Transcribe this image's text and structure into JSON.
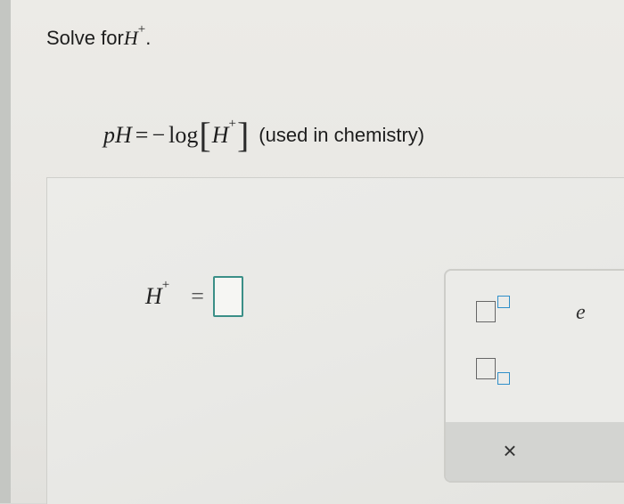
{
  "prompt": {
    "text": "Solve for ",
    "variable": "H",
    "superscript": "+",
    "period": "."
  },
  "formula": {
    "lhs": "pH",
    "equals": "=",
    "minus": "−",
    "func": "log",
    "open_bracket": "[",
    "arg": "H",
    "arg_superscript": "+",
    "close_bracket": "]",
    "note": "(used in chemistry)"
  },
  "answer": {
    "variable": "H",
    "superscript": "+",
    "equals": "=",
    "value": ""
  },
  "toolbar": {
    "superscript_tool": "superscript-template-icon",
    "subscript_tool": "subscript-template-icon",
    "e_label": "e",
    "clear_label": "×",
    "undo_label": "↶"
  },
  "colors": {
    "answer_box_border": "#3b8f87",
    "template_accent": "#2f8fc9"
  }
}
